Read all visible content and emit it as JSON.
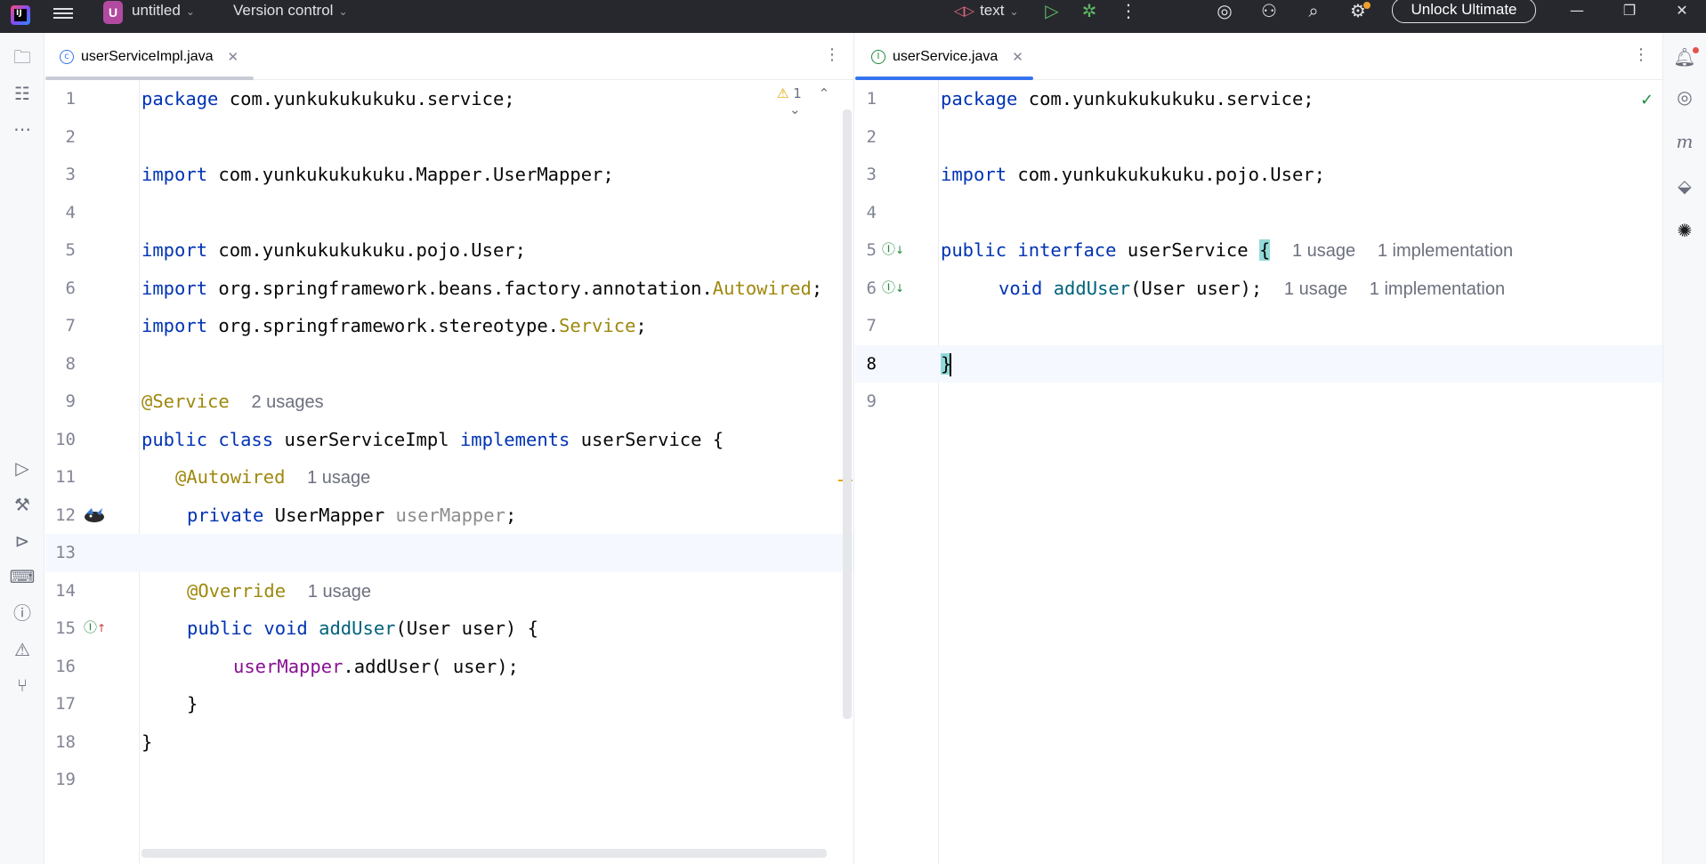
{
  "titlebar": {
    "project_badge": "U",
    "project_name": "untitled",
    "vcs_label": "Version control",
    "run_config": "text",
    "unlock_label": "Unlock Ultimate"
  },
  "left_editor": {
    "tab_label": "userServiceImpl.java",
    "warning_count": "1",
    "lines": [
      {
        "n": "1"
      },
      {
        "n": "2"
      },
      {
        "n": "3"
      },
      {
        "n": "4"
      },
      {
        "n": "5"
      },
      {
        "n": "6"
      },
      {
        "n": "7"
      },
      {
        "n": "8"
      },
      {
        "n": "9"
      },
      {
        "n": "10"
      },
      {
        "n": "11"
      },
      {
        "n": "12"
      },
      {
        "n": "13"
      },
      {
        "n": "14"
      },
      {
        "n": "15"
      },
      {
        "n": "16"
      },
      {
        "n": "17"
      },
      {
        "n": "18"
      },
      {
        "n": "19"
      }
    ],
    "code": {
      "l1_kw": "package",
      "l1_rest": " com.yunkukukukuku.service;",
      "l3_kw": "import",
      "l3_rest": " com.yunkukukukuku.Mapper.UserMapper;",
      "l5_kw": "import",
      "l5_rest": " com.yunkukukukuku.pojo.User;",
      "l6_kw": "import",
      "l6_rest": " org.springframework.beans.factory.annotation.",
      "l6_ann": "Autowired",
      "l6_end": ";",
      "l7_kw": "import",
      "l7_rest": " org.springframework.stereotype.",
      "l7_ann": "Service",
      "l7_end": ";",
      "l9_ann": "@Service",
      "l9_hint": "2 usages",
      "l10_kw1": "public class",
      "l10_name": " userServiceImpl ",
      "l10_kw2": "implements",
      "l10_rest": " userService {",
      "l11_ann": "@Autowired",
      "l11_hint": "1 usage",
      "l12_kw": "private",
      "l12_type": " UserMapper ",
      "l12_fld": "userMapper",
      "l12_end": ";",
      "l14_ann": "@Override",
      "l14_hint": "1 usage",
      "l15_kw": "public void",
      "l15_mth": " addUser",
      "l15_rest": "(User user) {",
      "l16_fld": "userMapper",
      "l16_rest": ".addUser( user);",
      "l17": "}",
      "l18": "}"
    }
  },
  "right_editor": {
    "tab_label": "userService.java",
    "lines": [
      {
        "n": "1"
      },
      {
        "n": "2"
      },
      {
        "n": "3"
      },
      {
        "n": "4"
      },
      {
        "n": "5"
      },
      {
        "n": "6"
      },
      {
        "n": "7"
      },
      {
        "n": "8"
      },
      {
        "n": "9"
      }
    ],
    "code": {
      "l1_kw": "package",
      "l1_rest": " com.yunkukukukuku.service;",
      "l3_kw": "import",
      "l3_rest": " com.yunkukukukuku.pojo.User;",
      "l5_kw": "public interface",
      "l5_rest": " userService ",
      "l5_brace": "{",
      "l5_hint1": "1 usage",
      "l5_hint2": "1 implementation",
      "l6_kw": "void",
      "l6_mth": " addUser",
      "l6_rest": "(User user);",
      "l6_hint1": "1 usage",
      "l6_hint2": "1 implementation",
      "l8_brace": "}"
    }
  },
  "icons": {
    "left_strip": [
      "folder-icon",
      "structure-icon",
      "more-icon",
      "run-icon",
      "build-icon",
      "services-icon",
      "terminal-icon",
      "problems-icon",
      "warning-icon",
      "git-icon"
    ],
    "right_strip": [
      "notifications-icon",
      "ai-assistant-icon",
      "maven-icon",
      "plugins-icon",
      "spring-icon"
    ]
  },
  "colors": {
    "keyword": "#0033b3",
    "annotation": "#9e880d",
    "field": "#871094",
    "method": "#00627a",
    "accent": "#3574f0"
  }
}
